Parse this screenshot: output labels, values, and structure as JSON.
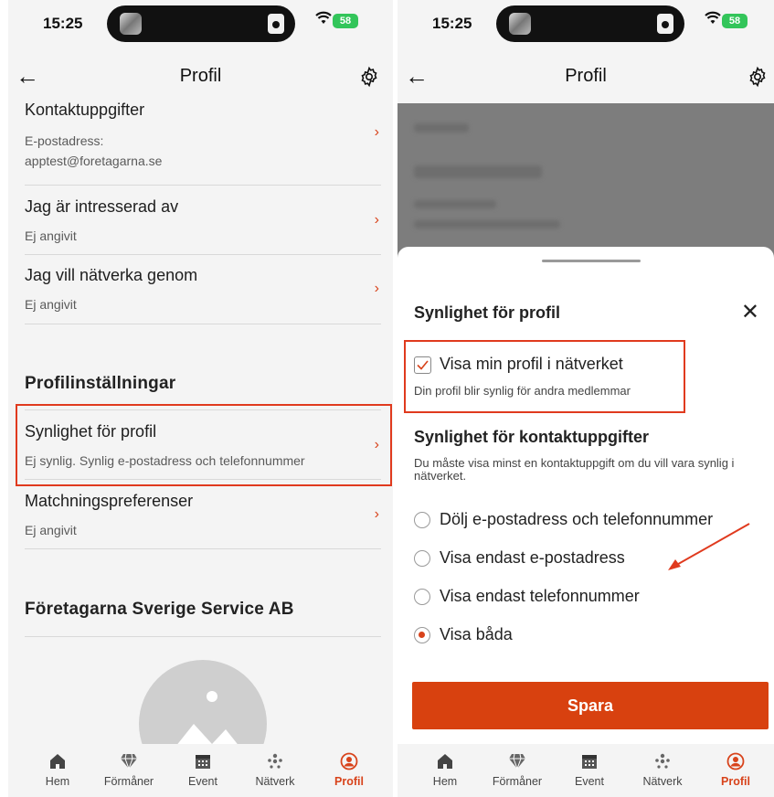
{
  "status": {
    "time": "15:25",
    "battery": "58"
  },
  "left": {
    "header": {
      "title": "Profil"
    },
    "contact": {
      "title": "Kontaktuppgifter",
      "sub1": "E-postadress:",
      "sub2": "apptest@foretagarna.se"
    },
    "interests": {
      "title": "Jag är intresserad av",
      "sub": "Ej angivit"
    },
    "network": {
      "title": "Jag vill nätverka genom",
      "sub": "Ej angivit"
    },
    "section_settings": "Profilinställningar",
    "visibility": {
      "title": "Synlighet för profil",
      "sub": "Ej synlig. Synlig e-postadress och telefonnummer"
    },
    "matching": {
      "title": "Matchningspreferenser",
      "sub": "Ej angivit"
    },
    "company": "Företagarna Sverige Service AB"
  },
  "right": {
    "header": {
      "title": "Profil"
    },
    "sheet": {
      "title": "Synlighet för profil",
      "checkbox_label": "Visa min profil i nätverket",
      "checkbox_help": "Din profil blir synlig för andra medlemmar",
      "checkbox_checked": true,
      "contact_title": "Synlighet för kontaktuppgifter",
      "contact_desc": "Du måste visa minst en kontaktuppgift om du vill vara synlig i nätverket.",
      "options": [
        {
          "label": "Dölj e-postadress och telefonnummer",
          "selected": false
        },
        {
          "label": "Visa endast e-postadress",
          "selected": false
        },
        {
          "label": "Visa endast telefonnummer",
          "selected": false
        },
        {
          "label": "Visa båda",
          "selected": true
        }
      ],
      "save_label": "Spara"
    }
  },
  "nav": {
    "items": [
      {
        "label": "Hem",
        "icon": "home-icon"
      },
      {
        "label": "Förmåner",
        "icon": "diamond-icon"
      },
      {
        "label": "Event",
        "icon": "calendar-icon"
      },
      {
        "label": "Nätverk",
        "icon": "network-icon"
      },
      {
        "label": "Profil",
        "icon": "profile-icon"
      }
    ],
    "active": "Profil"
  },
  "colors": {
    "accent": "#d8431b",
    "highlight": "#e03a1e",
    "save_button": "#d8410f"
  }
}
